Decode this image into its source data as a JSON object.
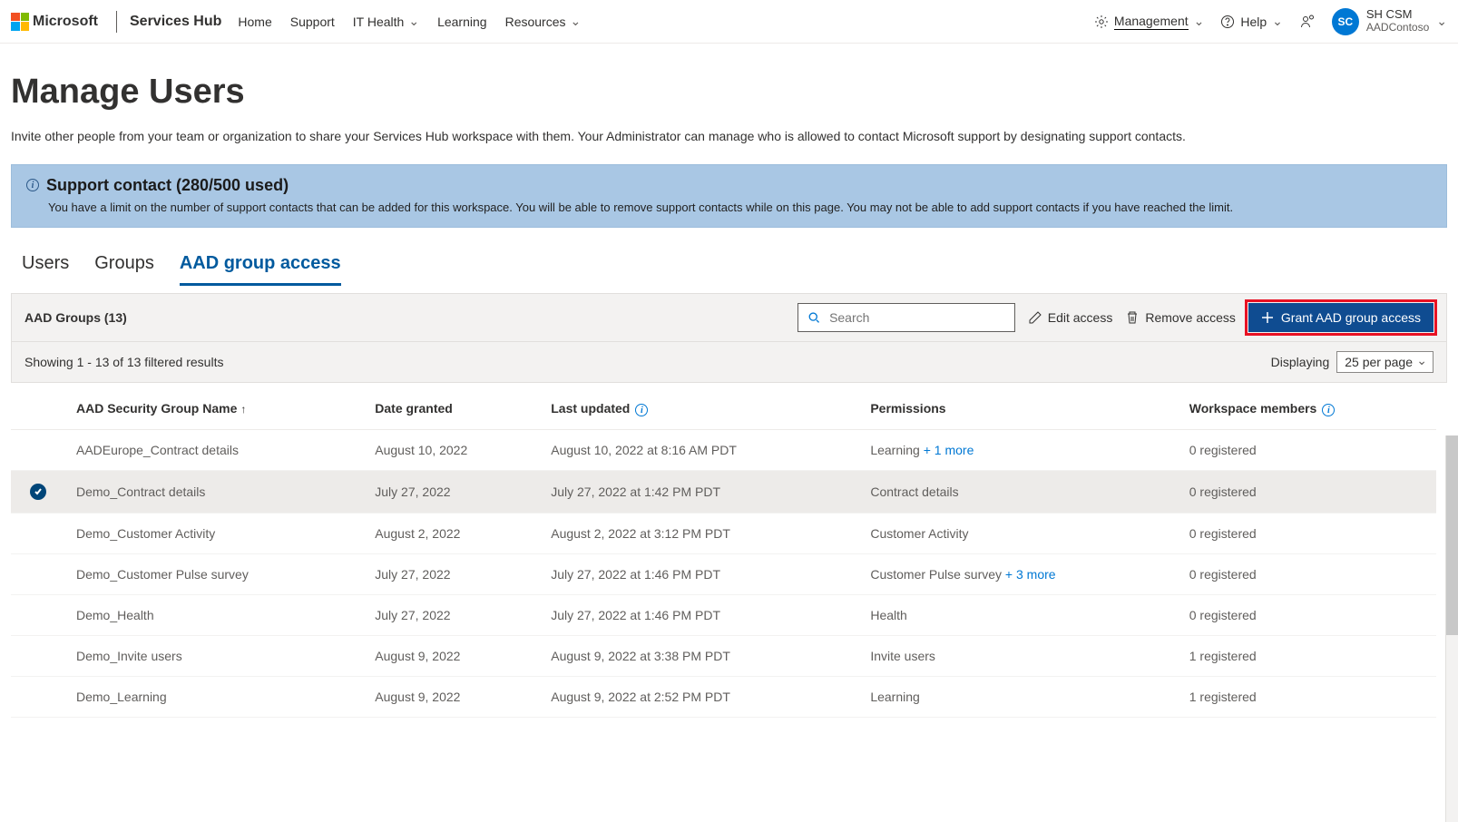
{
  "header": {
    "microsoft": "Microsoft",
    "hub": "Services Hub",
    "nav": [
      "Home",
      "Support",
      "IT Health",
      "Learning",
      "Resources"
    ],
    "nav_has_chevron": [
      false,
      false,
      true,
      false,
      true
    ],
    "management": "Management",
    "help": "Help",
    "user": {
      "initials": "SC",
      "name": "SH CSM",
      "org": "AADContoso"
    }
  },
  "page": {
    "title": "Manage Users",
    "subtitle": "Invite other people from your team or organization to share your Services Hub workspace with them. Your Administrator can manage who is allowed to contact Microsoft support by designating support contacts."
  },
  "info": {
    "heading": "Support contact (280/500 used)",
    "detail": "You have a limit on the number of support contacts that can be added for this workspace. You will be able to remove support contacts while on this page. You may not be able to add support contacts if you have reached the limit."
  },
  "tabs": [
    "Users",
    "Groups",
    "AAD group access"
  ],
  "active_tab": 2,
  "toolbar": {
    "section_title": "AAD Groups (13)",
    "search_placeholder": "Search",
    "edit": "Edit access",
    "remove": "Remove access",
    "grant": "Grant AAD group access"
  },
  "subbar": {
    "results": "Showing 1 - 13 of 13 filtered results",
    "displaying": "Displaying",
    "per_page": "25 per page"
  },
  "columns": [
    "AAD Security Group Name",
    "Date granted",
    "Last updated",
    "Permissions",
    "Workspace members"
  ],
  "rows": [
    {
      "sel": false,
      "name": "AADEurope_Contract details",
      "date": "August 10, 2022",
      "updated": "August 10, 2022 at 8:16 AM PDT",
      "perm": "Learning",
      "perm_more": "+ 1 more",
      "members": "0 registered"
    },
    {
      "sel": true,
      "name": "Demo_Contract details",
      "date": "July 27, 2022",
      "updated": "July 27, 2022 at 1:42 PM PDT",
      "perm": "Contract details",
      "perm_more": "",
      "members": "0 registered"
    },
    {
      "sel": false,
      "name": "Demo_Customer Activity",
      "date": "August 2, 2022",
      "updated": "August 2, 2022 at 3:12 PM PDT",
      "perm": "Customer Activity",
      "perm_more": "",
      "members": "0 registered"
    },
    {
      "sel": false,
      "name": "Demo_Customer Pulse survey",
      "date": "July 27, 2022",
      "updated": "July 27, 2022 at 1:46 PM PDT",
      "perm": "Customer Pulse survey",
      "perm_more": "+ 3 more",
      "members": "0 registered"
    },
    {
      "sel": false,
      "name": "Demo_Health",
      "date": "July 27, 2022",
      "updated": "July 27, 2022 at 1:46 PM PDT",
      "perm": "Health",
      "perm_more": "",
      "members": "0 registered"
    },
    {
      "sel": false,
      "name": "Demo_Invite users",
      "date": "August 9, 2022",
      "updated": "August 9, 2022 at 3:38 PM PDT",
      "perm": "Invite users",
      "perm_more": "",
      "members": "1 registered"
    },
    {
      "sel": false,
      "name": "Demo_Learning",
      "date": "August 9, 2022",
      "updated": "August 9, 2022 at 2:52 PM PDT",
      "perm": "Learning",
      "perm_more": "",
      "members": "1 registered"
    }
  ]
}
